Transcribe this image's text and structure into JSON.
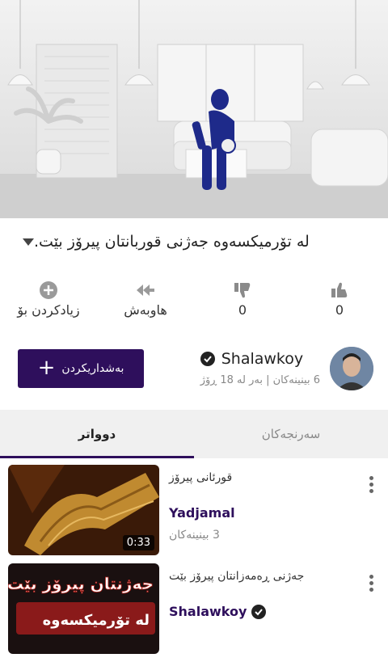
{
  "video": {
    "title": "لە تۆرمیکسەوە جەژنی قوربانتان پیرۆز بێت."
  },
  "actions": [
    {
      "icon": "plus-circle-icon",
      "label": "زیادکردن بۆ"
    },
    {
      "icon": "share-icon",
      "label": "هاوبەش"
    },
    {
      "icon": "thumbs-down-icon",
      "label": "0"
    },
    {
      "icon": "thumbs-up-icon",
      "label": "0"
    }
  ],
  "channel": {
    "name": "Shalawkoy",
    "meta": "6 بینینەکان | بەر لە 18 ڕۆژ",
    "subscribe_label": "بەشداریکردن"
  },
  "tabs": [
    "سەرنجەکان",
    "دوواتر"
  ],
  "active_tab": "دوواتر",
  "list": [
    {
      "title": "قورئانی پیرۆز",
      "channel": "Yadjamal",
      "views": "3 بینینەکان",
      "duration": "0:33",
      "verified": false
    },
    {
      "title": "جەژنی ڕەمەزانتان پیرۆز بێت",
      "channel": "Shalawkoy",
      "views": "",
      "duration": "",
      "verified": true,
      "thumb_text": [
        "جەژنتان پیرۆز بێت",
        "لە تۆرمیکسەوە"
      ]
    }
  ],
  "colors": {
    "accent": "#2e0f5c",
    "tab_bg": "#f0f0f0"
  }
}
